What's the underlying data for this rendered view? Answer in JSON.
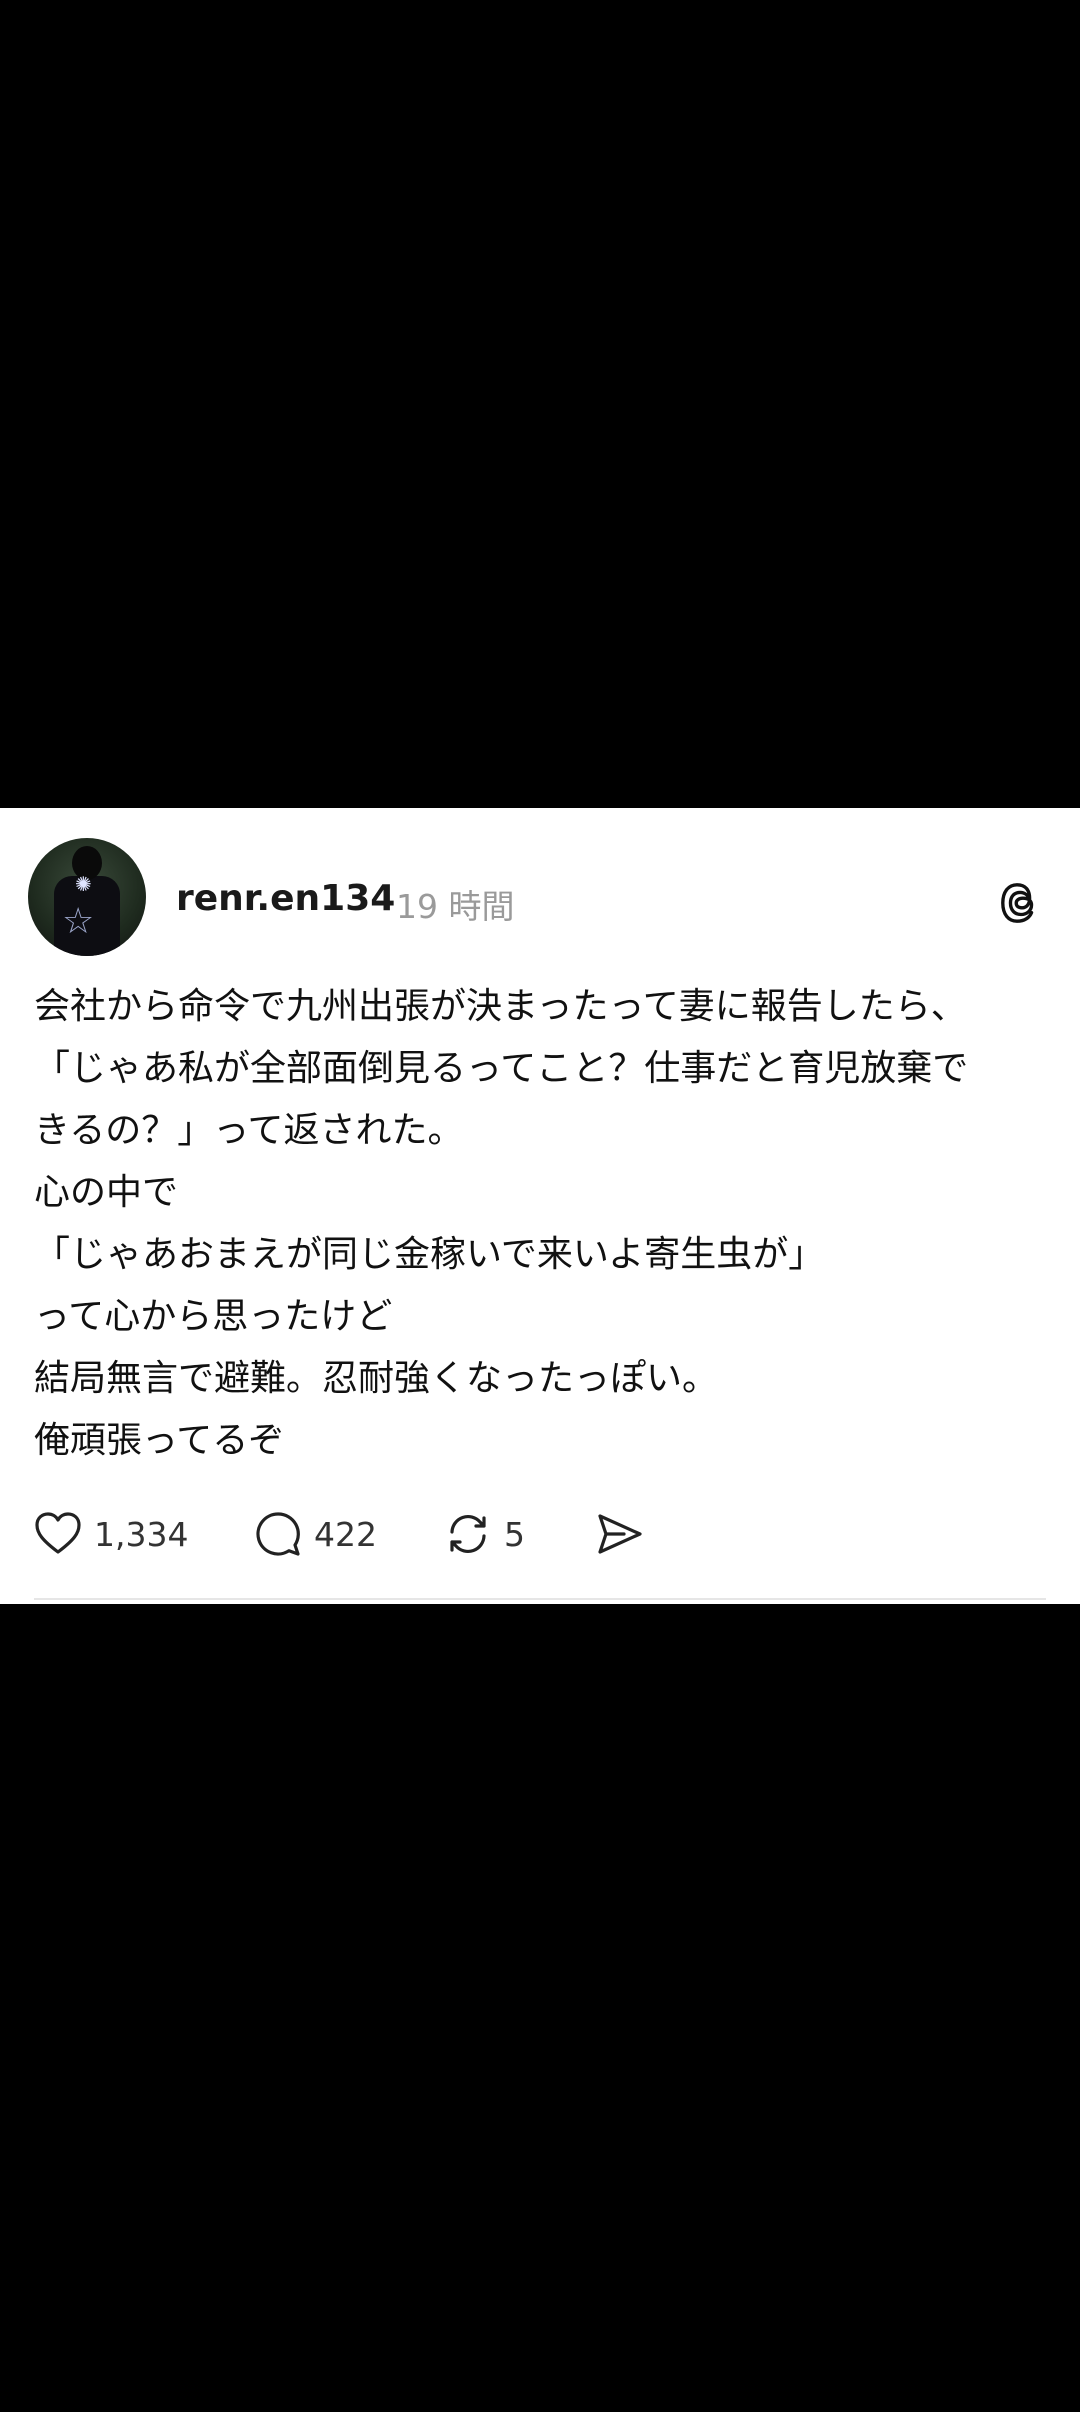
{
  "post": {
    "username": "renr.en134",
    "timestamp": "19 時間",
    "lines": [
      "会社から命令で九州出張が決まったって妻に報告したら、",
      "「じゃあ私が全部面倒見るってこと？仕事だと育児放棄で",
      "きるの？」って返された。",
      "心の中で",
      "「じゃあおまえが同じ金稼いで来いよ寄生虫が」",
      "って心から思ったけど",
      "結局無言で避難。忍耐強くなったっぽい。",
      "俺頑張ってるぞ"
    ]
  },
  "actions": {
    "likes": "1,334",
    "replies": "422",
    "reposts": "5",
    "like_icon": "heart-icon",
    "reply_icon": "comment-icon",
    "repost_icon": "repost-icon",
    "share_icon": "send-icon"
  },
  "app_icon": "threads-logo-icon"
}
